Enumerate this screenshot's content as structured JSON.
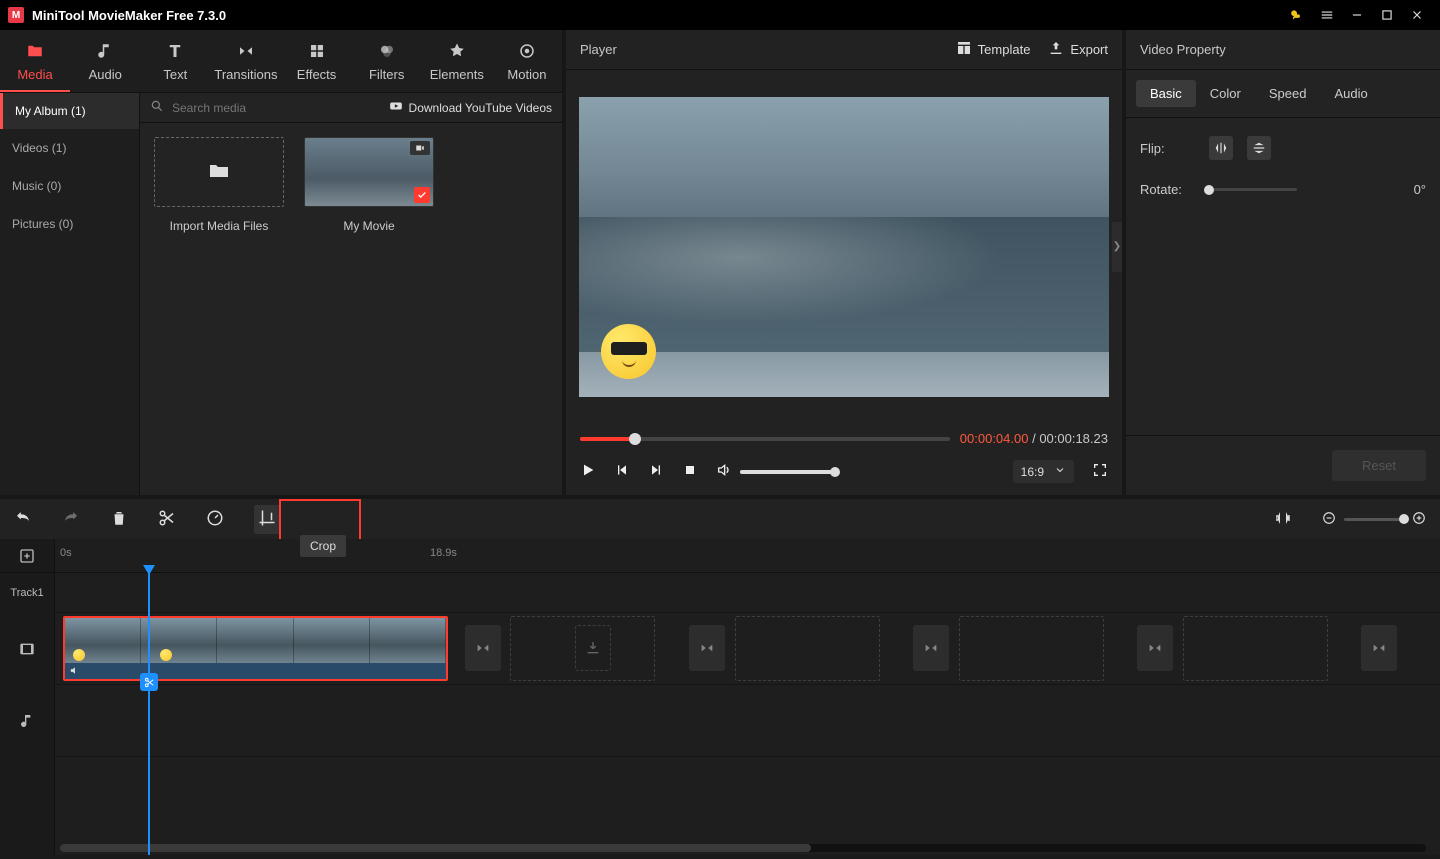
{
  "app": {
    "title": "MiniTool MovieMaker Free 7.3.0"
  },
  "topTabs": {
    "media": "Media",
    "audio": "Audio",
    "text": "Text",
    "transitions": "Transitions",
    "effects": "Effects",
    "filters": "Filters",
    "elements": "Elements",
    "motion": "Motion"
  },
  "album": {
    "header": "My Album (1)",
    "items": {
      "videos": "Videos (1)",
      "music": "Music (0)",
      "pictures": "Pictures (0)"
    }
  },
  "search": {
    "placeholder": "Search media",
    "download": "Download YouTube Videos"
  },
  "thumbs": {
    "import": "Import Media Files",
    "movie": "My Movie"
  },
  "player": {
    "title": "Player",
    "template": "Template",
    "export": "Export",
    "current": "00:00:04.00",
    "sep": " / ",
    "total": "00:00:18.23",
    "ratio": "16:9"
  },
  "props": {
    "header": "Video Property",
    "tabs": {
      "basic": "Basic",
      "color": "Color",
      "speed": "Speed",
      "audio": "Audio"
    },
    "flip": "Flip:",
    "rotate": "Rotate:",
    "rotateVal": "0°",
    "reset": "Reset"
  },
  "toolbar": {
    "cropTooltip": "Crop"
  },
  "timeline": {
    "t0": "0s",
    "t1": "18.9s",
    "trackLabel": "Track1"
  }
}
